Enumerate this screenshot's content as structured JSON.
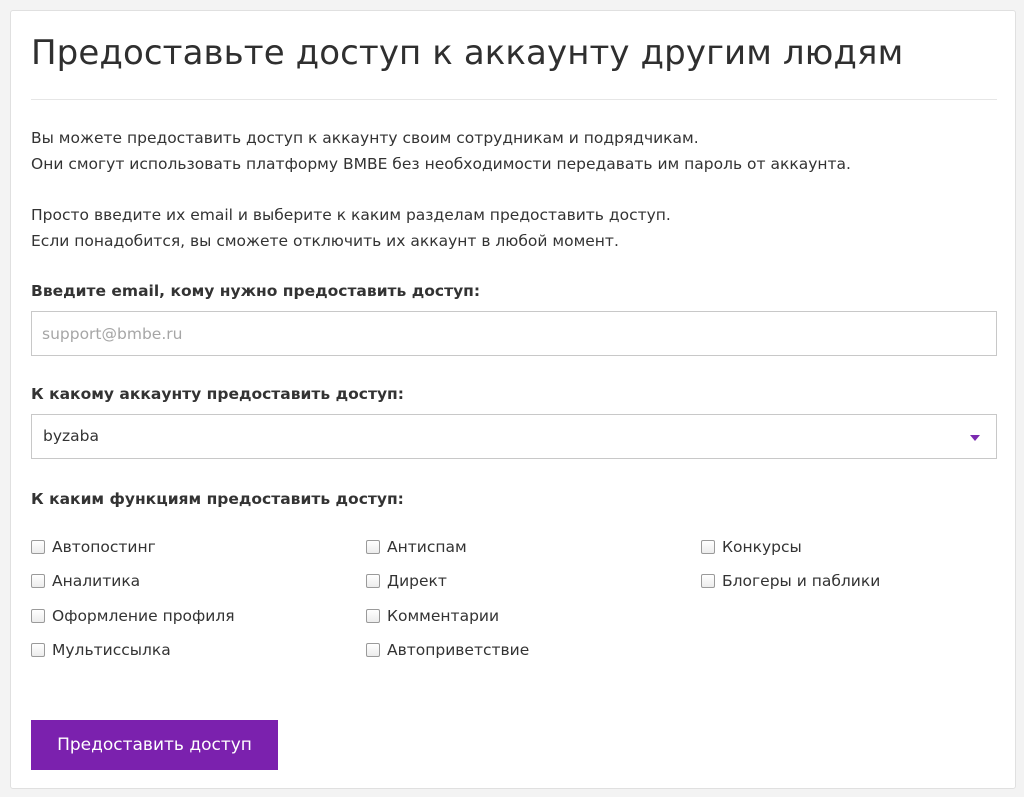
{
  "title": "Предоставьте доступ к аккаунту другим людям",
  "intro": {
    "line1": "Вы можете предоставить доступ к аккаунту своим сотрудникам и подрядчикам.",
    "line2": "Они смогут использовать платформу BMBE без необходимости передавать им пароль от аккаунта.",
    "line3": "Просто введите их email и выберите к каким разделам предоставить доступ.",
    "line4": "Если понадобится, вы сможете отключить их аккаунт в любой момент."
  },
  "email": {
    "label": "Введите email, кому нужно предоставить доступ:",
    "placeholder": "support@bmbe.ru",
    "value": ""
  },
  "account": {
    "label": "К какому аккаунту предоставить доступ:",
    "selected": "byzaba"
  },
  "functions": {
    "label": "К каким функциям предоставить доступ:",
    "items": [
      {
        "label": "Автопостинг",
        "checked": false
      },
      {
        "label": "Аналитика",
        "checked": false
      },
      {
        "label": "Оформление профиля",
        "checked": false
      },
      {
        "label": "Мультиссылка",
        "checked": false
      },
      {
        "label": "Антиспам",
        "checked": false
      },
      {
        "label": "Директ",
        "checked": false
      },
      {
        "label": "Комментарии",
        "checked": false
      },
      {
        "label": "Автоприветствие",
        "checked": false
      },
      {
        "label": "Конкурсы",
        "checked": false
      },
      {
        "label": "Блогеры и паблики",
        "checked": false
      }
    ]
  },
  "submit_label": "Предоставить доступ",
  "colors": {
    "accent": "#7b21ae",
    "arrow": "#7b2ab0"
  }
}
